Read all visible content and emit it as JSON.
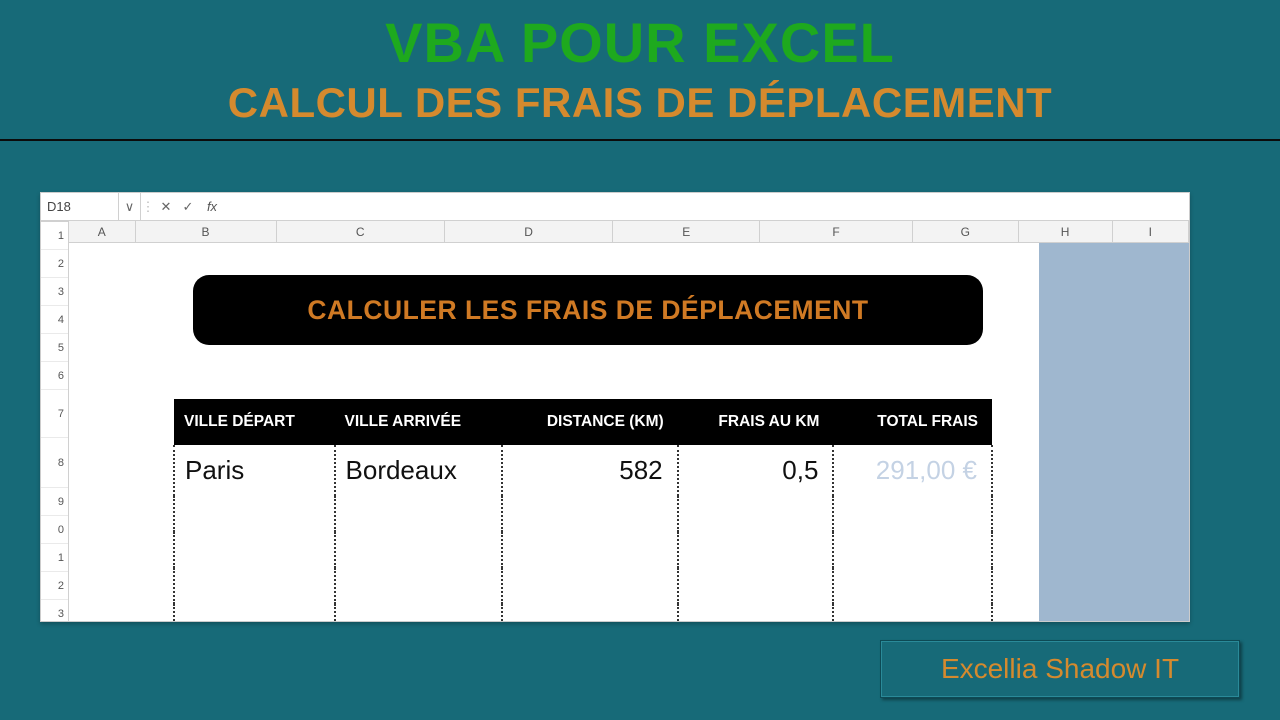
{
  "header": {
    "title_main": "VBA POUR EXCEL",
    "title_sub": "CALCUL DES FRAIS DE DÉPLACEMENT"
  },
  "formula_bar": {
    "name_box": "D18",
    "dropdown_glyph": "∨",
    "sep_glyph": "⋮",
    "cancel_glyph": "✕",
    "confirm_glyph": "✓",
    "fx_label": "fx",
    "value": ""
  },
  "columns": [
    "A",
    "B",
    "C",
    "D",
    "E",
    "F",
    "G",
    "H",
    "I"
  ],
  "rows": [
    "1",
    "2",
    "3",
    "4",
    "5",
    "6",
    "7",
    "8",
    "9",
    "0",
    "1",
    "2",
    "3"
  ],
  "big_button_label": "CALCULER LES FRAIS DE DÉPLACEMENT",
  "table": {
    "headers": {
      "depart": "VILLE DÉPART",
      "arrivee": "VILLE ARRIVÉE",
      "distance": "DISTANCE (KM)",
      "frais_km": "FRAIS AU KM",
      "total": "TOTAL FRAIS"
    },
    "row": {
      "depart": "Paris",
      "arrivee": "Bordeaux",
      "distance": "582",
      "frais_km": "0,5",
      "total": "291,00 €"
    }
  },
  "credit": "Excellia Shadow IT",
  "colors": {
    "bg": "#176a78",
    "green": "#1ea91e",
    "orange": "#d58a2e",
    "selection": "#9fb7cf"
  }
}
